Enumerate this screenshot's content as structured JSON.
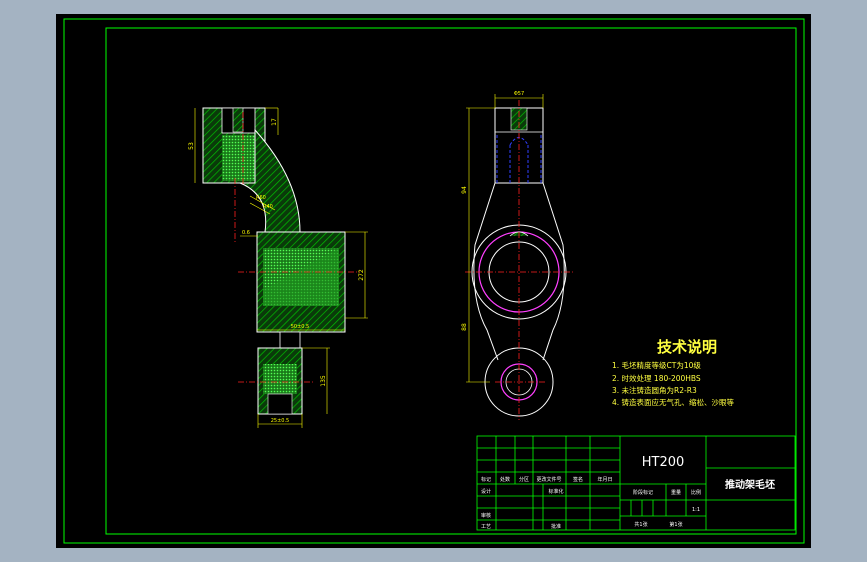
{
  "tech_notes": {
    "title": "技术说明",
    "items": [
      "1. 毛坯精度等级CT为10级",
      "2. 时效处理 180-200HBS",
      "3. 未注铸造圆角为R2-R3",
      "4. 铸造表面应无气孔、缩松、沙眼等"
    ]
  },
  "title_block": {
    "material": "HT200",
    "part_name": "推动架毛坯",
    "scale": "1:1",
    "row_labels": [
      "标记",
      "处数",
      "分区",
      "更改文件号",
      "签名",
      "年月日"
    ],
    "design": "设计",
    "standardize": "标准化",
    "review": "审核",
    "process": "工艺",
    "approve": "批准",
    "stage_mark": "阶段标记",
    "weight": "重量",
    "scale_label": "比例",
    "total_sheets": "共1张",
    "sheet_no": "第1张"
  },
  "dimensions": {
    "left_top_height": "17",
    "left_upper_height": "53",
    "left_radius_1": "R60",
    "left_radius_2": "R40",
    "left_offset": "0.6",
    "left_bore_height": "272",
    "left_mid_width": "50±0.5",
    "left_lower_height": "135",
    "left_lower_width": "25±0.5",
    "right_top_width": "Φ57",
    "right_upper_height": "94",
    "right_lower_height": "88"
  },
  "colors": {
    "background": "#000000",
    "frame": "#00ff00",
    "outline": "#ffffff",
    "hatch": "#00c000",
    "centerline": "#ff2020",
    "dimension": "#ffff00",
    "circle": "#ff40ff",
    "hidden": "#3040ff",
    "tech_text": "#ffff40",
    "title_text": "#ffffff"
  }
}
